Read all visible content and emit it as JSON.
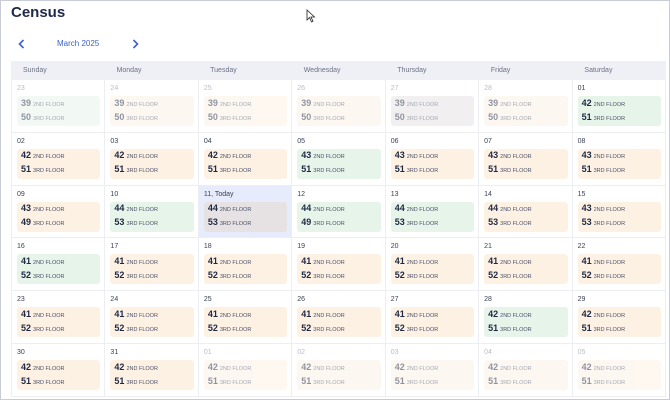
{
  "app": {
    "title": "Census"
  },
  "month": {
    "label": "March 2025"
  },
  "weekdays": [
    "Sunday",
    "Monday",
    "Tuesday",
    "Wednesday",
    "Thursday",
    "Friday",
    "Saturday"
  ],
  "floors": {
    "second": "2ND FLOOR",
    "third": "3RD FLOOR"
  },
  "colors": {
    "accent": "#3b62c9",
    "orange_card": "#fdf1e4",
    "green_card": "#e6f4ea",
    "today_bg": "#e6ecfb"
  },
  "days": [
    {
      "label": "23",
      "f2": "39",
      "f3": "50",
      "color": "green",
      "dim": true
    },
    {
      "label": "24",
      "f2": "39",
      "f3": "50",
      "color": "orange",
      "dim": true
    },
    {
      "label": "25",
      "f2": "39",
      "f3": "50",
      "color": "orange",
      "dim": true
    },
    {
      "label": "26",
      "f2": "39",
      "f3": "50",
      "color": "orange",
      "dim": true
    },
    {
      "label": "27",
      "f2": "39",
      "f3": "50",
      "color": "gray",
      "dim": true
    },
    {
      "label": "28",
      "f2": "39",
      "f3": "50",
      "color": "orange",
      "dim": true
    },
    {
      "label": "01",
      "f2": "42",
      "f3": "51",
      "color": "green"
    },
    {
      "label": "02",
      "f2": "42",
      "f3": "51",
      "color": "orange"
    },
    {
      "label": "03",
      "f2": "42",
      "f3": "51",
      "color": "orange"
    },
    {
      "label": "04",
      "f2": "42",
      "f3": "51",
      "color": "orange"
    },
    {
      "label": "05",
      "f2": "43",
      "f3": "51",
      "color": "green"
    },
    {
      "label": "06",
      "f2": "43",
      "f3": "51",
      "color": "orange"
    },
    {
      "label": "07",
      "f2": "43",
      "f3": "51",
      "color": "orange"
    },
    {
      "label": "08",
      "f2": "43",
      "f3": "51",
      "color": "orange"
    },
    {
      "label": "09",
      "f2": "43",
      "f3": "49",
      "color": "orange"
    },
    {
      "label": "10",
      "f2": "44",
      "f3": "53",
      "color": "green"
    },
    {
      "label": "11, Today",
      "f2": "44",
      "f3": "53",
      "color": "gray",
      "today": true
    },
    {
      "label": "12",
      "f2": "44",
      "f3": "49",
      "color": "green"
    },
    {
      "label": "13",
      "f2": "44",
      "f3": "53",
      "color": "green"
    },
    {
      "label": "14",
      "f2": "44",
      "f3": "53",
      "color": "orange"
    },
    {
      "label": "15",
      "f2": "43",
      "f3": "53",
      "color": "orange"
    },
    {
      "label": "16",
      "f2": "41",
      "f3": "52",
      "color": "green"
    },
    {
      "label": "17",
      "f2": "41",
      "f3": "52",
      "color": "orange"
    },
    {
      "label": "18",
      "f2": "41",
      "f3": "52",
      "color": "orange"
    },
    {
      "label": "19",
      "f2": "41",
      "f3": "52",
      "color": "orange"
    },
    {
      "label": "20",
      "f2": "41",
      "f3": "52",
      "color": "orange"
    },
    {
      "label": "21",
      "f2": "41",
      "f3": "52",
      "color": "orange"
    },
    {
      "label": "22",
      "f2": "41",
      "f3": "52",
      "color": "orange"
    },
    {
      "label": "23",
      "f2": "41",
      "f3": "52",
      "color": "orange"
    },
    {
      "label": "24",
      "f2": "41",
      "f3": "52",
      "color": "orange"
    },
    {
      "label": "25",
      "f2": "41",
      "f3": "52",
      "color": "orange"
    },
    {
      "label": "26",
      "f2": "41",
      "f3": "52",
      "color": "orange"
    },
    {
      "label": "27",
      "f2": "41",
      "f3": "52",
      "color": "orange"
    },
    {
      "label": "28",
      "f2": "42",
      "f3": "51",
      "color": "green"
    },
    {
      "label": "29",
      "f2": "42",
      "f3": "51",
      "color": "orange"
    },
    {
      "label": "30",
      "f2": "42",
      "f3": "51",
      "color": "orange"
    },
    {
      "label": "31",
      "f2": "42",
      "f3": "51",
      "color": "orange"
    },
    {
      "label": "01",
      "f2": "42",
      "f3": "51",
      "color": "orange",
      "dim": true
    },
    {
      "label": "02",
      "f2": "42",
      "f3": "51",
      "color": "orange",
      "dim": true
    },
    {
      "label": "03",
      "f2": "42",
      "f3": "51",
      "color": "orange",
      "dim": true
    },
    {
      "label": "04",
      "f2": "42",
      "f3": "51",
      "color": "orange",
      "dim": true
    },
    {
      "label": "05",
      "f2": "42",
      "f3": "51",
      "color": "orange",
      "dim": true
    }
  ]
}
